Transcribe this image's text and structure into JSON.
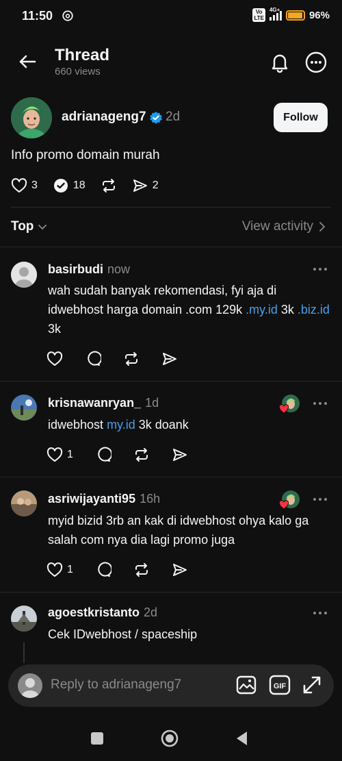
{
  "status_bar": {
    "time": "11:50",
    "network_badge": "Vo\nLTE",
    "network_type": "4G+",
    "battery_percent": "96%",
    "battery_level": 0.96,
    "battery_color": "#f5a623"
  },
  "header": {
    "title": "Thread",
    "views": "660 views",
    "icons": [
      "back-arrow-icon",
      "bell-icon",
      "more-circle-icon"
    ]
  },
  "original_post": {
    "username": "adrianageng7",
    "verified": true,
    "time": "2d",
    "follow_label": "Follow",
    "text": "Info promo domain murah",
    "likes": "3",
    "quotes": "18",
    "shares": "2",
    "verified_color": "#1d9bf0"
  },
  "sort": {
    "label": "Top",
    "view_activity": "View activity"
  },
  "replies": [
    {
      "username": "basirbudi",
      "time": "now",
      "text_parts": [
        {
          "t": "wah sudah banyak rekomendasi, fyi aja di idwebhost harga domain .com 129k ",
          "link": false
        },
        {
          "t": ".my.id",
          "link": true
        },
        {
          "t": " 3k ",
          "link": false
        },
        {
          "t": ".biz.id",
          "link": true
        },
        {
          "t": " 3k",
          "link": false
        }
      ],
      "likes": ""
    },
    {
      "username": "krisnawanryan_",
      "time": "1d",
      "text_parts": [
        {
          "t": "idwebhost ",
          "link": false
        },
        {
          "t": "my.id",
          "link": true
        },
        {
          "t": " 3k doank",
          "link": false
        }
      ],
      "likes": "1",
      "liked_by_author": true
    },
    {
      "username": "asriwijayanti95",
      "time": "16h",
      "text_parts": [
        {
          "t": "myid bizid 3rb an kak di idwebhost ohya kalo ga salah com nya dia lagi promo juga",
          "link": false
        }
      ],
      "likes": "1",
      "liked_by_author": true
    },
    {
      "username": "agoestkristanto",
      "time": "2d",
      "text_parts": [
        {
          "t": "Cek IDwebhost / spaceship",
          "link": false
        }
      ],
      "likes": ""
    }
  ],
  "reply_bar": {
    "placeholder": "Reply to adrianageng7",
    "icons": [
      "image-icon",
      "gif-icon",
      "expand-icon"
    ]
  },
  "nav": {
    "icons": [
      "recents-square-icon",
      "home-circle-icon",
      "back-triangle-icon"
    ]
  },
  "link_color": "#4a9de8",
  "like_color": "#ff3040"
}
